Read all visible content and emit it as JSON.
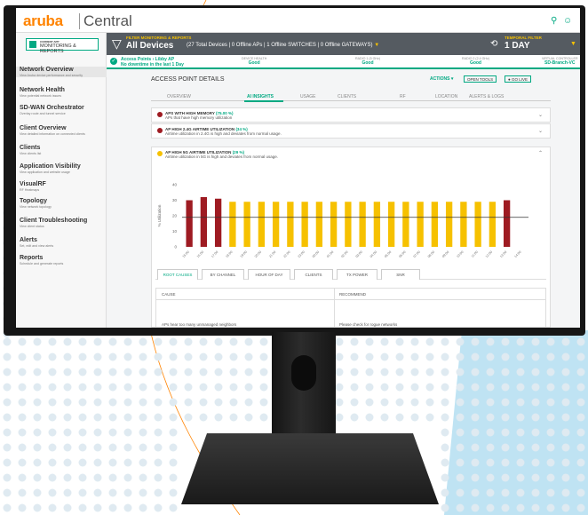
{
  "app": {
    "logo": "aruba",
    "product": "Central"
  },
  "topbar": {
    "search_icon": "search-icon",
    "user_icon": "user-icon"
  },
  "sidebar": {
    "current_app_label": "CURRENT APP",
    "current_app": "MONITORING & REPORTS",
    "items": [
      {
        "title": "Network Overview",
        "desc": "View Aruba device performance and security"
      },
      {
        "title": "Network Health",
        "desc": "View potential network issues"
      },
      {
        "title": "SD-WAN Orchestrator",
        "desc": "Overlay route and tunnel service"
      },
      {
        "title": "Client Overview",
        "desc": "View detailed information on connected clients"
      },
      {
        "title": "Clients",
        "desc": "View clients list"
      },
      {
        "title": "Application Visibility",
        "desc": "View application and website usage"
      },
      {
        "title": "VisualRF",
        "desc": "RF Heatmaps"
      },
      {
        "title": "Topology",
        "desc": "View network topology"
      },
      {
        "title": "Client Troubleshooting",
        "desc": "View client status"
      },
      {
        "title": "Alerts",
        "desc": "Set, edit and view alerts"
      },
      {
        "title": "Reports",
        "desc": "Schedule and generate reports"
      }
    ]
  },
  "filter": {
    "label": "FILTER MONITORING & REPORTS",
    "title": "All Devices",
    "summary": "(27 Total Devices | 0 Offline APs | 1 Offline SWITCHES | 0 Offline GATEWAYS)",
    "temporal_label": "TEMPORAL FILTER",
    "temporal_value": "1 DAY"
  },
  "status": {
    "line1": "Access Points › Libby AP",
    "line2": "No downtime in the last 1 Day",
    "metrics": [
      {
        "label": "DEVICE HEALTH",
        "value": "Good"
      },
      {
        "label": "RADIO 1 (5 GHz)",
        "value": "Good"
      },
      {
        "label": "RADIO 2 (2.4 GHz)",
        "value": "Good"
      },
      {
        "label": "VIRTUAL CONTROLLER",
        "value": "SD-Branch-VC"
      }
    ]
  },
  "main": {
    "title": "ACCESS POINT DETAILS",
    "actions": "ACTIONS",
    "open_tools": "OPEN TOOLS",
    "go_live": "GO LIVE",
    "tabs": [
      "OVERVIEW",
      "AI INSIGHTS",
      "USAGE",
      "CLIENTS",
      "RF",
      "LOCATION",
      "ALERTS & LOGS"
    ],
    "insights": [
      {
        "title": "APS WITH HIGH MEMORY",
        "pct": "(75.00 %)",
        "desc": "APs that have high memory utilization",
        "color": "#9e1b22"
      },
      {
        "title": "AP HIGH 2.4G AIRTIME UTILIZATION",
        "pct": "(34 %)",
        "desc": "Airtime utilization in 2.4G is high and deviates from normal usage.",
        "color": "#9e1b22"
      },
      {
        "title": "AP HIGH 5G AIRTIME UTILIZATION",
        "pct": "(29 %)",
        "desc": "Airtime utilization in 5G is high and deviates from normal usage.",
        "color": "#f6c100"
      }
    ],
    "subtabs": [
      "ROOT CAUSES",
      "BY CHANNEL",
      "HOUR OF DAY",
      "CLIENTS",
      "TX POWER",
      "SNR"
    ],
    "table": {
      "headers": [
        "CAUSE",
        "RECOMMEND"
      ],
      "cause": "APs hear too many unmanaged neighbors",
      "recommend": "Please check for rogue networks"
    }
  },
  "chart_data": {
    "type": "bar",
    "ylabel": "% Utilization",
    "ylim": [
      0,
      40
    ],
    "yticks": [
      0,
      10,
      20,
      30,
      40
    ],
    "threshold": 19,
    "categories": [
      "15:00",
      "16:00",
      "17:00",
      "18:00",
      "19:00",
      "20:00",
      "21:00",
      "22:00",
      "23:00",
      "00:00",
      "01:00",
      "02:00",
      "03:00",
      "04:00",
      "05:00",
      "06:00",
      "07:00",
      "08:00",
      "09:00",
      "10:00",
      "11:00",
      "12:00",
      "13:00",
      "14:00"
    ],
    "values": [
      30,
      32,
      31,
      29,
      29,
      29,
      29,
      29,
      29,
      29,
      29,
      29,
      29,
      29,
      29,
      29,
      29,
      29,
      29,
      29,
      29,
      29,
      30,
      null
    ],
    "colors": {
      "high": "#9e1b22",
      "normal": "#f6c100",
      "threshold": "#333333"
    }
  }
}
